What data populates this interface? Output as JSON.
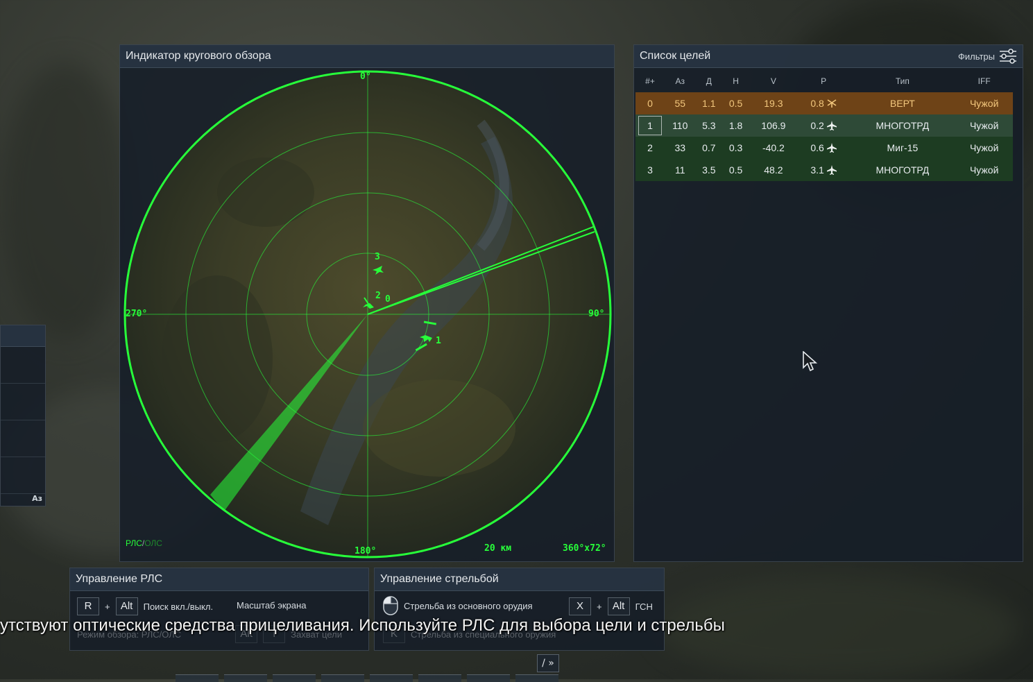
{
  "radar": {
    "title": "Индикатор кругового обзора",
    "deg_0": "0°",
    "deg_90": "90°",
    "deg_180": "180°",
    "deg_270": "270°",
    "mode_rls": "РЛС",
    "mode_sep": "/",
    "mode_ols": "ОЛС",
    "scale": "20 км",
    "sector": "360°x72°",
    "blip_labels": [
      "3",
      "2",
      "0",
      "1"
    ],
    "color": "#27ff3a"
  },
  "targets": {
    "title": "Список целей",
    "filters_label": "Фильтры",
    "columns": [
      "#+",
      "Аз",
      "Д",
      "Н",
      "V",
      "Р",
      "Тип",
      "IFF"
    ],
    "rows": [
      {
        "num": "0",
        "az": "55",
        "d": "1.1",
        "h": "0.5",
        "v": "19.3",
        "r": "0.8",
        "icon": "helicopter-icon",
        "type": "ВЕРТ",
        "iff": "Чужой"
      },
      {
        "num": "1",
        "az": "110",
        "d": "5.3",
        "h": "1.8",
        "v": "106.9",
        "r": "0.2",
        "icon": "jet-icon",
        "type": "МНОГОТРД",
        "iff": "Чужой"
      },
      {
        "num": "2",
        "az": "33",
        "d": "0.7",
        "h": "0.3",
        "v": "-40.2",
        "r": "0.6",
        "icon": "jet-icon",
        "type": "Миг-15",
        "iff": "Чужой"
      },
      {
        "num": "3",
        "az": "11",
        "d": "3.5",
        "h": "0.5",
        "v": "48.2",
        "r": "3.1",
        "icon": "jet-icon",
        "type": "МНОГОТРД",
        "iff": "Чужой"
      }
    ]
  },
  "left_panel": {
    "az_label": "Аз"
  },
  "radar_control": {
    "title": "Управление РЛС",
    "key_r": "R",
    "plus": "+",
    "key_alt": "Alt",
    "toggle_label": "Поиск вкл./выкл.",
    "scale_label": "Масштаб экрана",
    "hidden_mode": "Режим обзора: РЛС/ОЛС",
    "key_alt2": "Alt",
    "key_t": "T",
    "lock_label": "Захват цели"
  },
  "fire_control": {
    "title": "Управление стрельбой",
    "fire_label": "Стрельба из основного орудия",
    "key_x": "X",
    "plus": "+",
    "key_alt": "Alt",
    "seeker_label": "ГСН",
    "key_k": "K",
    "special_label": "Стрельба из специального оружия"
  },
  "subtitle": "утствуют оптические средства прицеливания. Используйте РЛС для выбора цели и стрельбы",
  "bottom": {
    "toggle": "/ »"
  }
}
